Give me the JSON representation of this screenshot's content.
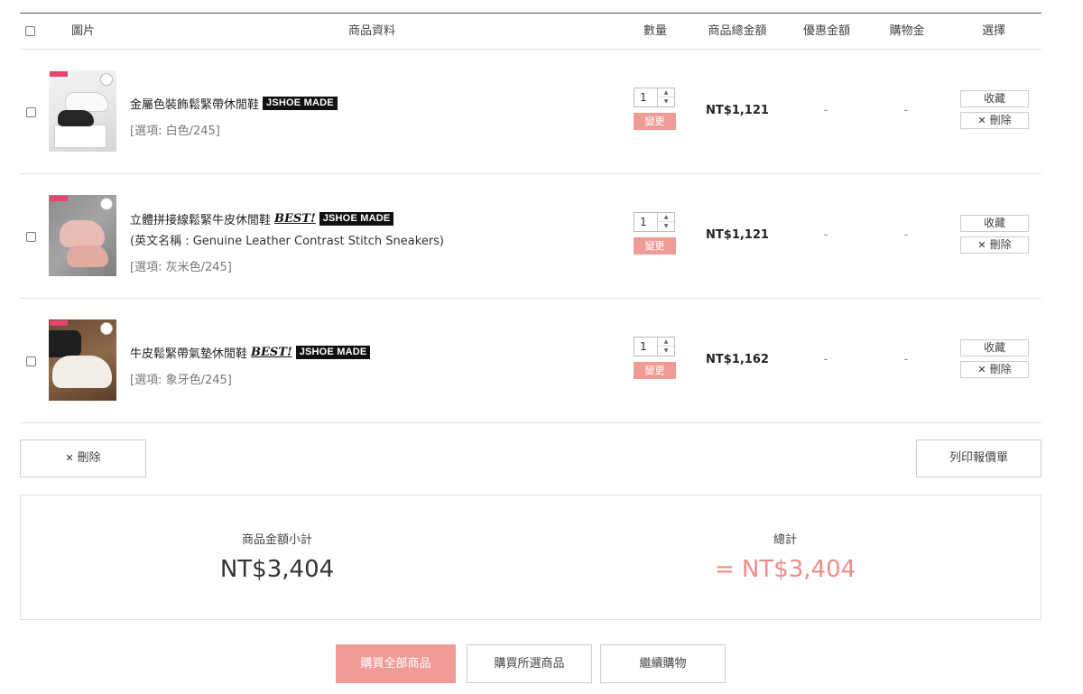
{
  "headers": {
    "image": "圖片",
    "info": "商品資料",
    "qty": "數量",
    "total": "商品總金額",
    "discount": "優惠金額",
    "credit": "購物金",
    "select": "選擇"
  },
  "items": [
    {
      "name": "金屬色裝飾鬆緊帶休閒鞋",
      "best": "",
      "brand_a": "JSHOE",
      "brand_b": "MADE",
      "english": "",
      "option": "[選項: 白色/245]",
      "qty": "1",
      "change": "變更",
      "total": "NT$1,121",
      "discount": "-",
      "credit": "-",
      "fav": "收藏",
      "delete": "刪除"
    },
    {
      "name": "立體拼接線鬆緊牛皮休閒鞋",
      "best": "BEST!",
      "brand_a": "JSHOE",
      "brand_b": "MADE",
      "english": "(英文名稱 : Genuine Leather Contrast Stitch Sneakers)",
      "option": "[選項: 灰米色/245]",
      "qty": "1",
      "change": "變更",
      "total": "NT$1,121",
      "discount": "-",
      "credit": "-",
      "fav": "收藏",
      "delete": "刪除"
    },
    {
      "name": "牛皮鬆緊帶氣墊休閒鞋",
      "best": "BEST!",
      "brand_a": "JSHOE",
      "brand_b": "MADE",
      "english": "",
      "option": "[選項: 象牙色/245]",
      "qty": "1",
      "change": "變更",
      "total": "NT$1,162",
      "discount": "-",
      "credit": "-",
      "fav": "收藏",
      "delete": "刪除"
    }
  ],
  "actions": {
    "delete_selected": "刪除",
    "print_quote": "列印報價單"
  },
  "summary": {
    "subtotal_label": "商品金額小計",
    "subtotal_value": "NT$3,404",
    "total_label": "總計",
    "total_value": "= NT$3,404"
  },
  "bottom": {
    "buy_all": "購買全部商品",
    "buy_selected": "購買所選商品",
    "continue": "繼續購物"
  },
  "colors": {
    "accent": "#ef9c97",
    "total_text": "#ef8c88"
  },
  "icons": {
    "delete": "close-icon",
    "spinner": "chevron-up-down-icon"
  }
}
